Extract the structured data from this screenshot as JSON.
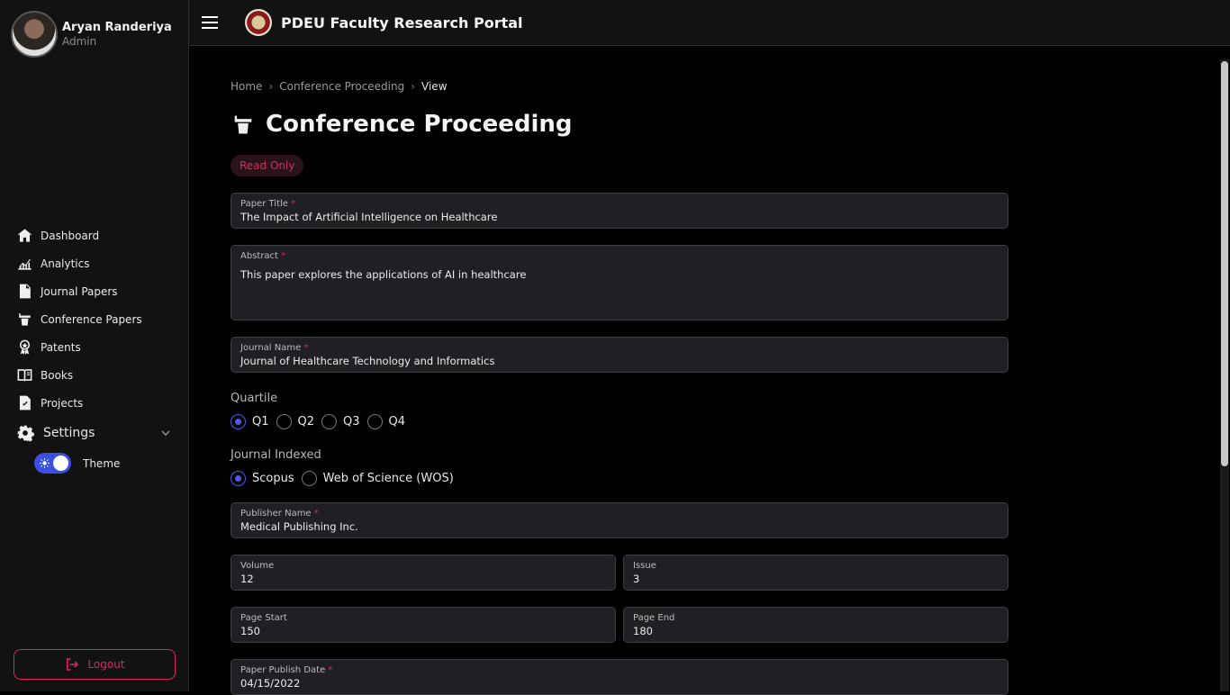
{
  "profile": {
    "name": "Aryan Randeriya",
    "role": "Admin"
  },
  "app": {
    "title": "PDEU Faculty Research Portal"
  },
  "sidebar": {
    "items": [
      {
        "label": "Dashboard",
        "icon": "home-icon"
      },
      {
        "label": "Analytics",
        "icon": "chart-icon"
      },
      {
        "label": "Journal Papers",
        "icon": "document-icon"
      },
      {
        "label": "Conference Papers",
        "icon": "podium-icon"
      },
      {
        "label": "Patents",
        "icon": "award-icon"
      },
      {
        "label": "Books",
        "icon": "book-icon"
      },
      {
        "label": "Projects",
        "icon": "clipboard-check-icon"
      }
    ],
    "settings_label": "Settings",
    "theme_label": "Theme",
    "logout_label": "Logout"
  },
  "breadcrumb": [
    "Home",
    "Conference Proceeding",
    "View"
  ],
  "page": {
    "title": "Conference Proceeding",
    "badge": "Read Only"
  },
  "form": {
    "paper_title": {
      "label": "Paper Title",
      "value": "The Impact of Artificial Intelligence on Healthcare"
    },
    "abstract": {
      "label": "Abstract",
      "value": "This paper explores the applications of AI in healthcare"
    },
    "journal_name": {
      "label": "Journal Name",
      "value": "Journal of Healthcare Technology and Informatics"
    },
    "quartile": {
      "label": "Quartile",
      "options": [
        "Q1",
        "Q2",
        "Q3",
        "Q4"
      ],
      "selected": "Q1"
    },
    "indexed": {
      "label": "Journal Indexed",
      "options": [
        "Scopus",
        "Web of Science (WOS)"
      ],
      "selected": "Scopus"
    },
    "publisher": {
      "label": "Publisher Name",
      "value": "Medical Publishing Inc."
    },
    "volume": {
      "label": "Volume",
      "value": "12"
    },
    "issue": {
      "label": "Issue",
      "value": "3"
    },
    "page_start": {
      "label": "Page Start",
      "value": "150"
    },
    "page_end": {
      "label": "Page End",
      "value": "180"
    },
    "publish_date": {
      "label": "Paper Publish Date",
      "value": "04/15/2022"
    }
  },
  "colors": {
    "accent": "#4a5cf0",
    "danger": "#e0245e"
  }
}
